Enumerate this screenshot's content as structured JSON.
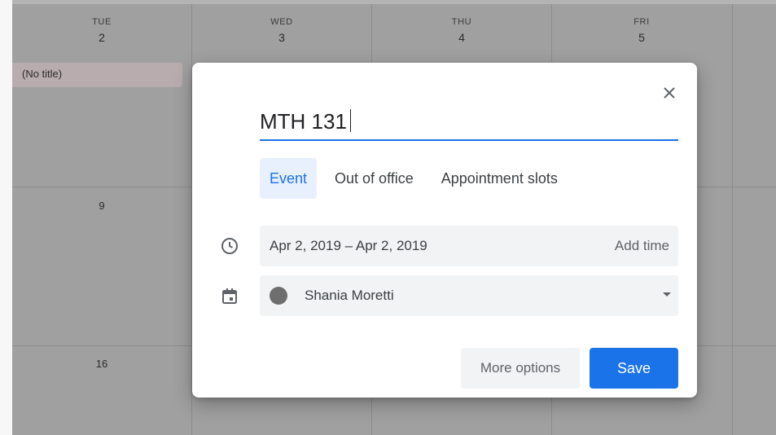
{
  "calendar": {
    "days": [
      {
        "dow": "TUE",
        "num": "2"
      },
      {
        "dow": "WED",
        "num": "3"
      },
      {
        "dow": "THU",
        "num": "4"
      },
      {
        "dow": "FRI",
        "num": "5"
      }
    ],
    "week_numbers": [
      "9",
      "16"
    ],
    "existing_event": "(No title)"
  },
  "dialog": {
    "title_value": "MTH 131",
    "tabs": [
      "Event",
      "Out of office",
      "Appointment slots"
    ],
    "active_tab": "Event",
    "date_range": "Apr 2, 2019  –  Apr 2, 2019",
    "add_time_label": "Add time",
    "calendar_owner": "Shania Moretti",
    "more_options_label": "More options",
    "save_label": "Save",
    "icons": {
      "close": "close-icon",
      "time": "clock-icon",
      "calendar": "calendar-icon",
      "dropdown": "caret-down-icon"
    }
  },
  "colors": {
    "accent": "#1a73e8",
    "active_tab_bg": "#e8f0fe",
    "calendar_dot": "#6e6e6e"
  }
}
